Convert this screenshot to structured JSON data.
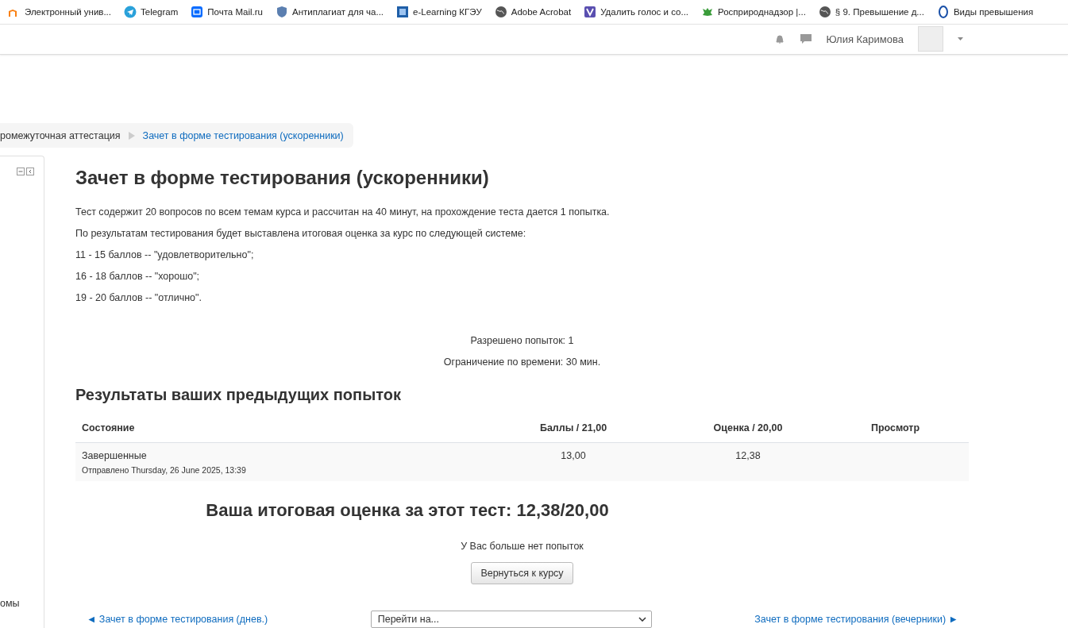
{
  "bookmarks": [
    {
      "label": "Электронный унив...",
      "kind": "moodle"
    },
    {
      "label": "Telegram",
      "kind": "telegram"
    },
    {
      "label": "Почта Mail.ru",
      "kind": "mail"
    },
    {
      "label": "Антиплагиат для ча...",
      "kind": "shield"
    },
    {
      "label": "e-Learning КГЭУ",
      "kind": "square"
    },
    {
      "label": "Adobe Acrobat",
      "kind": "globe"
    },
    {
      "label": "Удалить голос и со...",
      "kind": "v"
    },
    {
      "label": "Росприроднадзор |...",
      "kind": "eagle"
    },
    {
      "label": "§ 9. Превышение д...",
      "kind": "globe"
    },
    {
      "label": "Виды превышения",
      "kind": "ring"
    }
  ],
  "navbar": {
    "user_name": "Юлия Каримова"
  },
  "breadcrumb": [
    {
      "label": "ромежуточная аттестация",
      "kind": "text"
    },
    {
      "label": "Зачет в форме тестирования (ускоренники)",
      "kind": "link"
    }
  ],
  "sidebar": {
    "cut_text": "омы"
  },
  "title": "Зачет в форме тестирования (ускоренники)",
  "intro": [
    "Тест содержит 20 вопросов по всем темам курса и рассчитан на 40 минут, на прохождение теста дается 1 попытка.",
    "По результатам тестирования будет выставлена итоговая оценка за курс по следующей системе:",
    "11 - 15 баллов -- \"удовлетворительно\";",
    "16 - 18 баллов -- \"хорошо\";",
    "19 - 20 баллов -- \"отлично\"."
  ],
  "quiz_info": [
    "Разрешено попыток: 1",
    "Ограничение по времени: 30 мин."
  ],
  "results_heading": "Результаты ваших предыдущих попыток",
  "table": {
    "columns": [
      "Состояние",
      "Баллы / 21,00",
      "Оценка / 20,00",
      "Просмотр"
    ],
    "rows": [
      {
        "state": "Завершенные",
        "submitted": "Отправлено Thursday, 26 June 2025, 13:39",
        "points": "13,00",
        "grade": "12,38"
      }
    ]
  },
  "final_grade": "Ваша итоговая оценка за этот тест: 12,38/20,00",
  "no_attempts": "У Вас больше нет попыток",
  "back_button": "Вернуться к курсу",
  "activity_nav": {
    "prev": "◄ Зачет в форме тестирования (днев.)",
    "jump_placeholder": "Перейти на...",
    "next": "Зачет в форме тестирования (вечерники) ►"
  }
}
